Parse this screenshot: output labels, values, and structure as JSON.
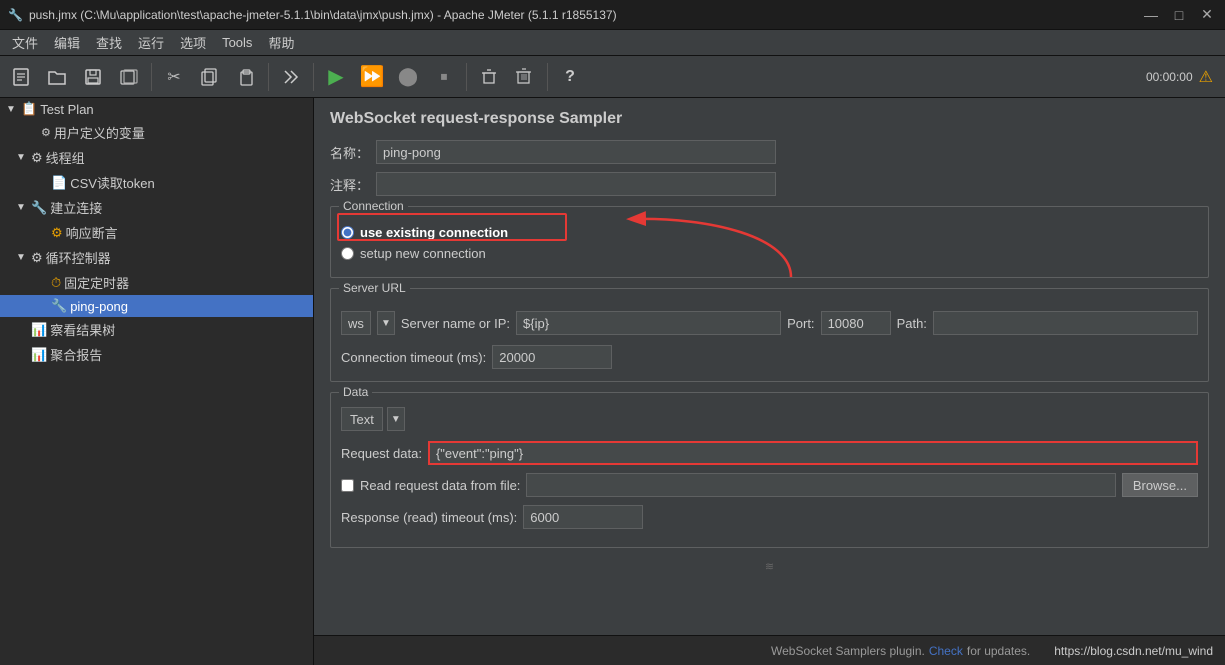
{
  "titlebar": {
    "title": "push.jmx (C:\\Mu\\application\\test\\apache-jmeter-5.1.1\\bin\\data\\jmx\\push.jmx) - Apache JMeter (5.1.1 r1855137)",
    "icon": "🔧"
  },
  "menubar": {
    "items": [
      "文件",
      "编辑",
      "查找",
      "运行",
      "选项",
      "Tools",
      "帮助"
    ]
  },
  "toolbar": {
    "time": "00:00:00",
    "warning_icon": "⚠"
  },
  "sidebar": {
    "items": [
      {
        "id": "test-plan",
        "label": "Test Plan",
        "level": 0,
        "arrow": "▼",
        "icon": "📋"
      },
      {
        "id": "user-vars",
        "label": "用户定义的变量",
        "level": 1,
        "arrow": "",
        "icon": "⚙"
      },
      {
        "id": "thread-group1",
        "label": "线程组",
        "level": 1,
        "arrow": "▼",
        "icon": "⚙"
      },
      {
        "id": "csv-token",
        "label": "CSV读取token",
        "level": 2,
        "arrow": "",
        "icon": "📄"
      },
      {
        "id": "establish-conn",
        "label": "建立连接",
        "level": 1,
        "arrow": "▼",
        "icon": "🔧"
      },
      {
        "id": "response-assert",
        "label": "响应断言",
        "level": 2,
        "arrow": "",
        "icon": "⚙"
      },
      {
        "id": "loop-ctrl",
        "label": "循环控制器",
        "level": 1,
        "arrow": "▼",
        "icon": "⚙"
      },
      {
        "id": "fixed-timer",
        "label": "固定定时器",
        "level": 2,
        "arrow": "",
        "icon": "⏱"
      },
      {
        "id": "ping-pong",
        "label": "ping-pong",
        "level": 2,
        "arrow": "",
        "icon": "🔧",
        "selected": true
      },
      {
        "id": "view-results",
        "label": "察看结果树",
        "level": 1,
        "arrow": "",
        "icon": "📊"
      },
      {
        "id": "agg-report",
        "label": "聚合报告",
        "level": 1,
        "arrow": "",
        "icon": "📊"
      }
    ]
  },
  "panel": {
    "title": "WebSocket request-response Sampler",
    "name_label": "名称：",
    "name_value": "ping-pong",
    "comment_label": "注释：",
    "comment_value": "",
    "connection": {
      "group_title": "Connection",
      "use_existing_label": "use existing connection",
      "setup_new_label": "setup new connection",
      "use_existing_selected": true
    },
    "server_url": {
      "group_title": "Server URL",
      "protocol_value": "ws",
      "server_name_label": "Server name or IP:",
      "server_name_value": "${ip}",
      "port_label": "Port:",
      "port_value": "10080",
      "path_label": "Path:",
      "path_value": "",
      "timeout_label": "Connection timeout (ms):",
      "timeout_value": "20000"
    },
    "data": {
      "group_title": "Data",
      "type_label": "Text",
      "request_data_label": "Request data:",
      "request_data_value": "{\"event\":\"ping\"}",
      "read_from_file_label": "Read request data from file:",
      "read_from_file_checked": false,
      "browse_label": "Browse...",
      "response_timeout_label": "Response (read) timeout (ms):",
      "response_timeout_value": "6000"
    }
  },
  "statusbar": {
    "plugin_text": "WebSocket Samplers plugin.",
    "check_label": "Check",
    "check_url": "#",
    "for_updates": "for updates.",
    "url": "https://blog.csdn.net/mu_wind"
  }
}
